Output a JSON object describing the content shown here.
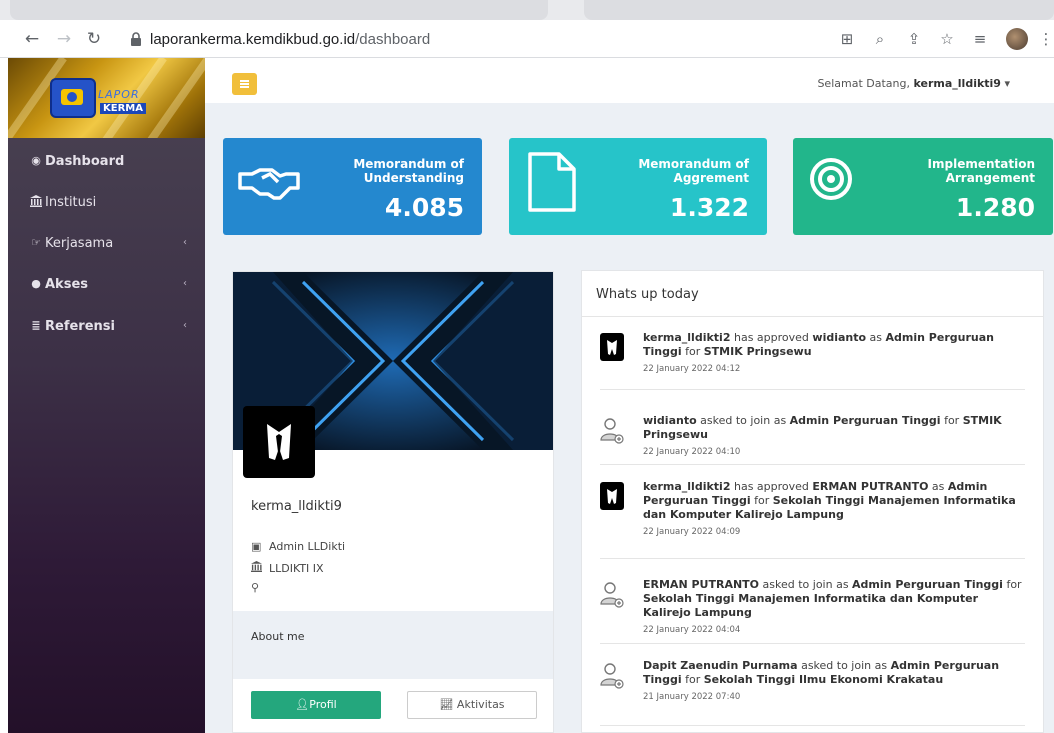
{
  "browser": {
    "url_domain": "laporankerma.kemdikbud.go.id",
    "url_path": "/dashboard"
  },
  "logo": {
    "line1": "LAPOR",
    "line2": "KERMA"
  },
  "sidebar": {
    "items": [
      {
        "label": "Dashboard",
        "icon": "palette-icon",
        "has_submenu": false
      },
      {
        "label": "Institusi",
        "icon": "institution-icon",
        "has_submenu": false
      },
      {
        "label": "Kerjasama",
        "icon": "handshake-icon",
        "has_submenu": true
      },
      {
        "label": "Akses",
        "icon": "globe-icon",
        "has_submenu": true
      },
      {
        "label": "Referensi",
        "icon": "database-icon",
        "has_submenu": true
      }
    ]
  },
  "header": {
    "welcome_prefix": "Selamat Datang,",
    "username": "kerma_lldikti9"
  },
  "stats": [
    {
      "title_line1": "Memorandum of",
      "title_line2": "Understanding",
      "value": "4.085",
      "color": "#2488cf",
      "icon": "handshake-icon"
    },
    {
      "title_line1": "Memorandum of",
      "title_line2": "Aggrement",
      "value": "1.322",
      "color": "#26c4c9",
      "icon": "document-icon"
    },
    {
      "title_line1": "Implementation",
      "title_line2": "Arrangement",
      "value": "1.280",
      "color": "#22b68b",
      "icon": "target-icon"
    }
  ],
  "profile": {
    "username": "kerma_lldikti9",
    "role": "Admin LLDikti",
    "institution": "LLDIKTI IX",
    "location": "",
    "about_title": "About me",
    "btn_profil": "Profil",
    "btn_aktivitas": "Aktivitas"
  },
  "feed": {
    "title": "Whats up today",
    "items": [
      {
        "avatar": "logo",
        "actor": "kerma_lldikti2",
        "verb": " has approved ",
        "target": "widianto",
        "mid": " as ",
        "role": "Admin Perguruan Tinggi",
        "for": " for ",
        "institution": "STMIK Pringsewu",
        "date": "22 January 2022 04:12"
      },
      {
        "avatar": "user",
        "actor": "widianto",
        "verb": " asked to join as ",
        "target": "",
        "mid": "",
        "role": "Admin Perguruan Tinggi",
        "for": " for ",
        "institution": "STMIK Pringsewu",
        "date": "22 January 2022 04:10"
      },
      {
        "avatar": "logo",
        "actor": "kerma_lldikti2",
        "verb": " has approved ",
        "target": "ERMAN PUTRANTO",
        "mid": " as ",
        "role": "Admin Perguruan Tinggi",
        "for": " for ",
        "institution": "Sekolah Tinggi Manajemen Informatika dan Komputer Kalirejo Lampung",
        "date": "22 January 2022 04:09"
      },
      {
        "avatar": "user",
        "actor": "ERMAN PUTRANTO",
        "verb": " asked to join as ",
        "target": "",
        "mid": "",
        "role": "Admin Perguruan Tinggi",
        "for": " for ",
        "institution": "Sekolah Tinggi Manajemen Informatika dan Komputer Kalirejo Lampung",
        "date": "22 January 2022 04:04"
      },
      {
        "avatar": "user",
        "actor": "Dapit Zaenudin Purnama",
        "verb": " asked to join as ",
        "target": "",
        "mid": "",
        "role": "Admin Perguruan Tinggi",
        "for": " for ",
        "institution": "Sekolah Tinggi Ilmu Ekonomi Krakatau",
        "date": "21 January 2022 07:40"
      }
    ]
  }
}
